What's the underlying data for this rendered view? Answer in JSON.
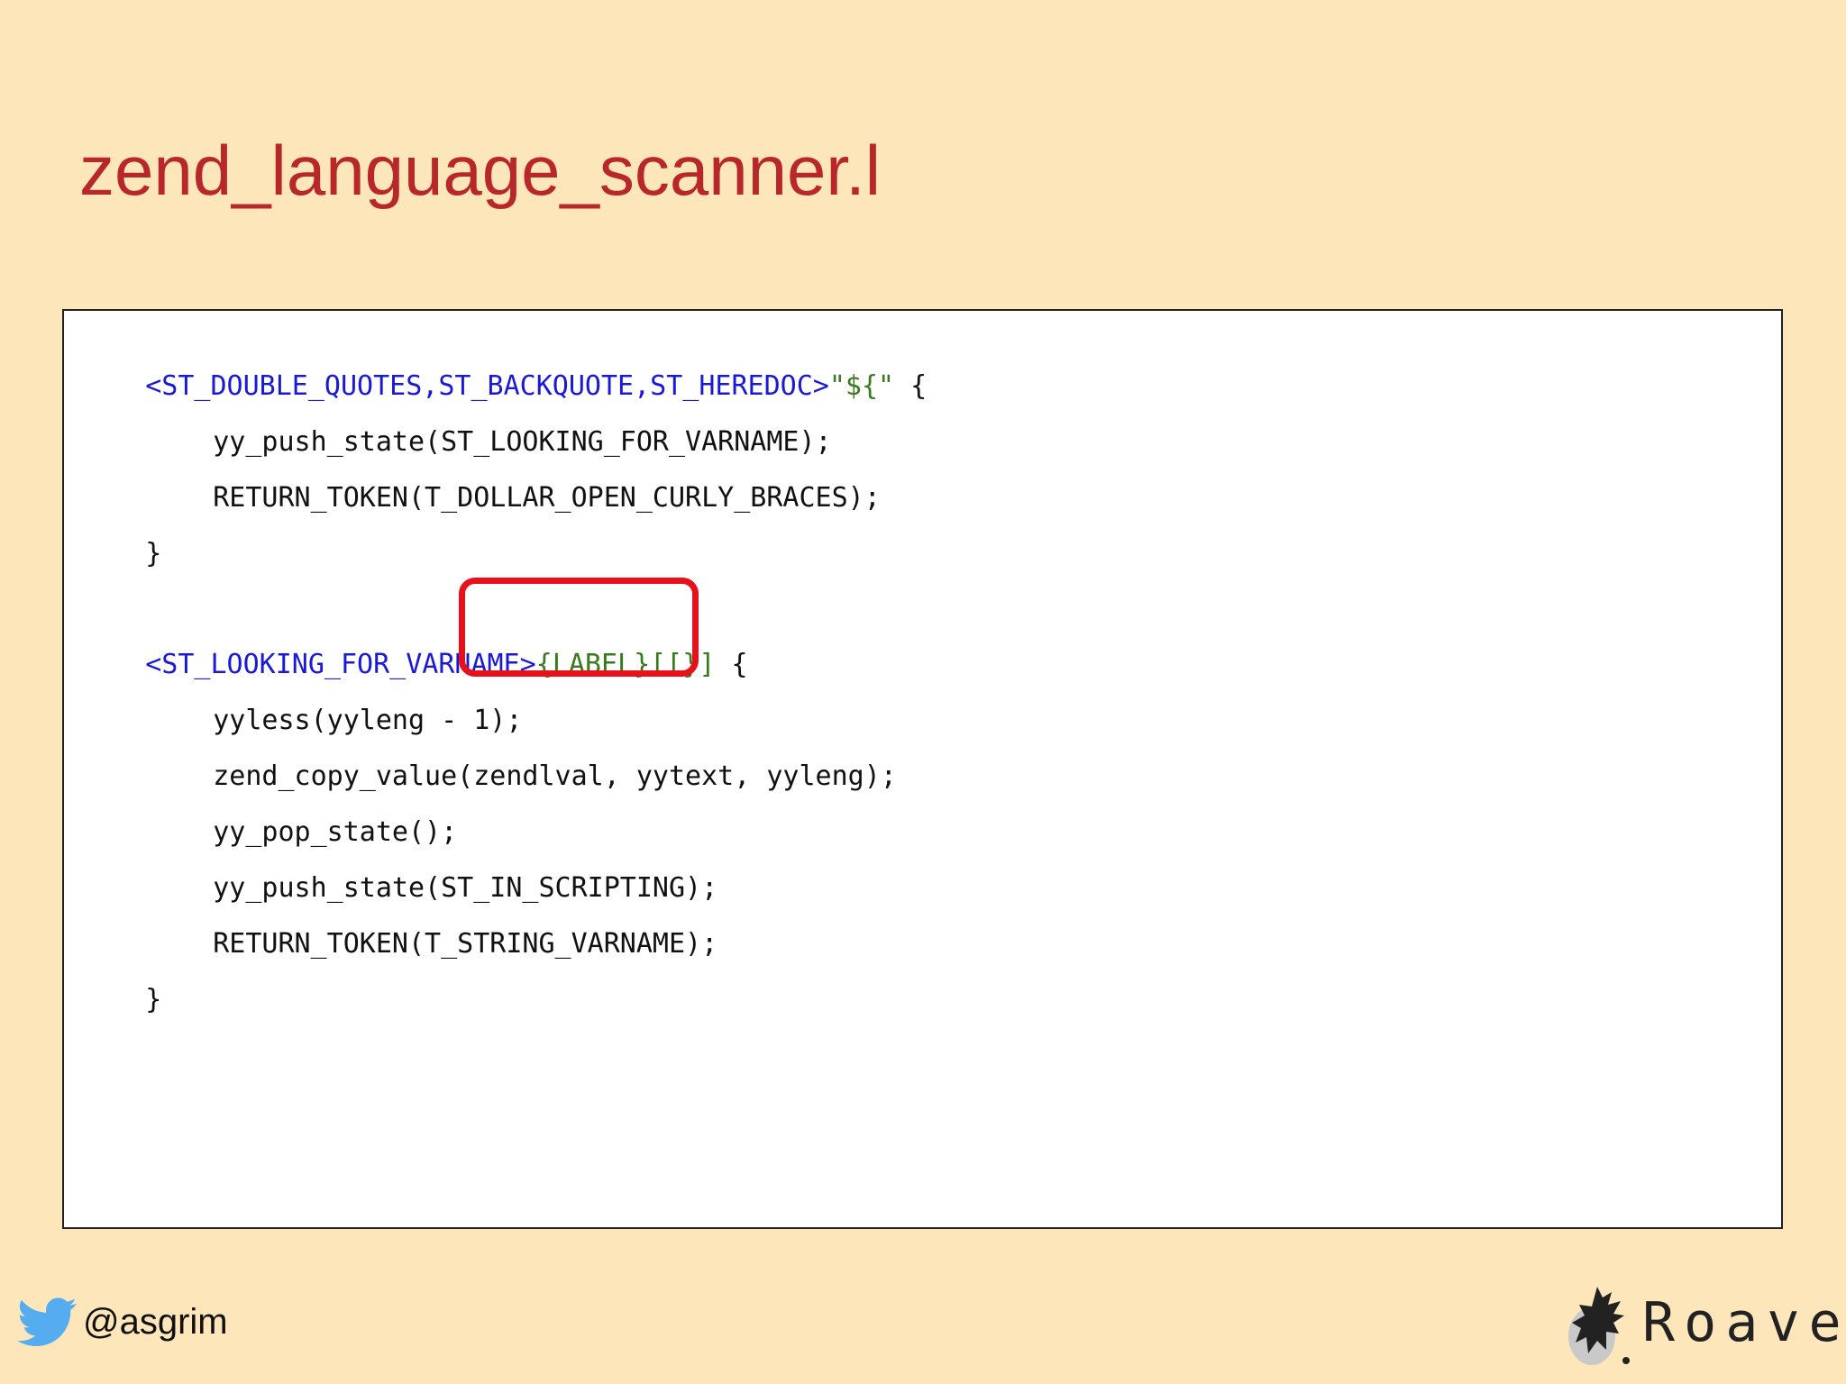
{
  "slide": {
    "title": "zend_language_scanner.l"
  },
  "code": {
    "lines": [
      [
        {
          "text": "<ST_DOUBLE_QUOTES,ST_BACKQUOTE,ST_HEREDOC>",
          "color": "#1a1ad6"
        },
        {
          "text": "\"${\"",
          "color": "#3a7a1e"
        },
        {
          "text": " {",
          "color": "#111111"
        }
      ],
      [
        {
          "text": "yy_push_state(ST_LOOKING_FOR_VARNAME);",
          "color": "#111111"
        }
      ],
      [
        {
          "text": "RETURN_TOKEN(T_DOLLAR_OPEN_CURLY_BRACES);",
          "color": "#111111"
        }
      ],
      [
        {
          "text": "}",
          "color": "#111111"
        }
      ],
      [],
      [
        {
          "text": "<ST_LOOKING_FOR_VARNAME>",
          "color": "#1a1ad6"
        },
        {
          "text": "{LABEL}[[}]",
          "color": "#3a7a1e"
        },
        {
          "text": " {",
          "color": "#111111"
        }
      ],
      [
        {
          "text": "yyless(yyleng - 1);",
          "color": "#111111"
        }
      ],
      [
        {
          "text": "zend_copy_value(zendlval, yytext, yyleng);",
          "color": "#111111"
        }
      ],
      [
        {
          "text": "yy_pop_state();",
          "color": "#111111"
        }
      ],
      [
        {
          "text": "yy_push_state(ST_IN_SCRIPTING);",
          "color": "#111111"
        }
      ],
      [
        {
          "text": "RETURN_TOKEN(T_STRING_VARNAME);",
          "color": "#111111"
        }
      ],
      [
        {
          "text": "}",
          "color": "#111111"
        }
      ]
    ],
    "highlight_color": "#e8101a"
  },
  "footer": {
    "twitter_handle": "@asgrim",
    "twitter_icon": "twitter-bird-icon",
    "brand_name": "Roave",
    "brand_icon": "roave-logo-icon"
  },
  "colors": {
    "background": "#fee6bb",
    "title": "#b8282a",
    "keyword_blue": "#1a1ad6",
    "string_green": "#3a7a1e",
    "twitter_blue": "#55acee"
  }
}
